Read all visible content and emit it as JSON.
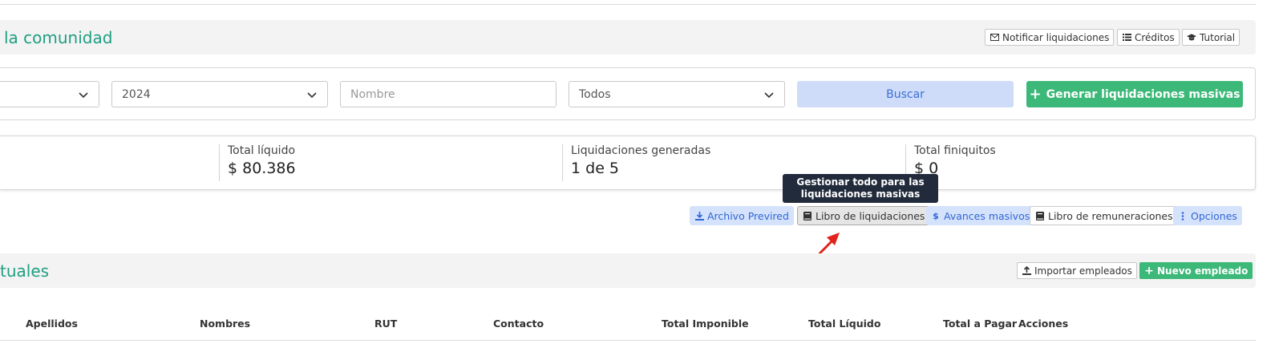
{
  "header1": {
    "title": "la comunidad",
    "buttons": [
      {
        "label": "Notificar liquidaciones",
        "icon": "envelope-icon"
      },
      {
        "label": "Créditos",
        "icon": "list-icon"
      },
      {
        "label": "Tutorial",
        "icon": "graduation-cap-icon"
      }
    ]
  },
  "filters": {
    "year": "2024",
    "name_placeholder": "Nombre",
    "status": "Todos",
    "search_label": "Buscar",
    "generate_label": "Generar liquidaciones masivas"
  },
  "stats": [
    {
      "label": "Total líquido",
      "value": "$ 80.386"
    },
    {
      "label": "Liquidaciones generadas",
      "value": "1 de 5"
    },
    {
      "label": "Total finiquitos",
      "value": "$ 0"
    }
  ],
  "tooltip": "Gestionar todo para las liquidaciones masivas",
  "actions": [
    {
      "label": "Archivo Previred",
      "icon": "download-icon"
    },
    {
      "label": "Libro de liquidaciones",
      "icon": "book-icon"
    },
    {
      "label": "Avances masivos",
      "icon": "dollar-icon"
    },
    {
      "label": "Libro de remuneraciones",
      "icon": "book-icon"
    },
    {
      "label": "Opciones",
      "icon": "vertical-dots-icon"
    }
  ],
  "header2": {
    "title": "tuales",
    "buttons": [
      {
        "label": "Importar empleados",
        "icon": "upload-icon"
      },
      {
        "label": "Nuevo empleado",
        "icon": "plus-icon"
      }
    ]
  },
  "table": {
    "columns": [
      "Apellidos",
      "Nombres",
      "RUT",
      "Contacto",
      "Total Imponible",
      "Total Líquido",
      "Total a Pagar",
      "Acciones"
    ]
  },
  "colors": {
    "brand_green": "#1f9e80",
    "button_green": "#3cb878",
    "action_blue": "#2f67d6",
    "action_blue_bg": "#d5e2fb",
    "tooltip_bg": "#222b3b",
    "arrow_red": "#e0231c"
  }
}
